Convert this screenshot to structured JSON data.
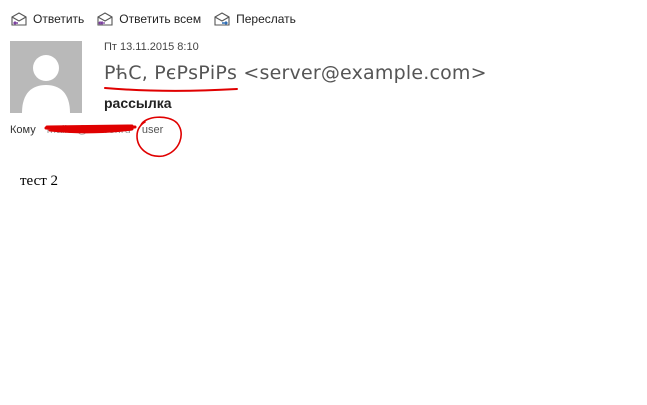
{
  "toolbar": {
    "reply_label": "Ответить",
    "reply_all_label": "Ответить всем",
    "forward_label": "Переслать"
  },
  "message": {
    "date": "Пт 13.11.2015 8:10",
    "sender_name": "РћС, РєРѕРіРѕ",
    "sender_email": "<server@example.com>",
    "subject": "рассылка",
    "to_label": "Кому",
    "to_redacted": "mailer@server.ru",
    "to_user": "user",
    "body_text": "тест 2"
  },
  "colors": {
    "annotation": "#e00000",
    "avatar_bg": "#b9b9b9",
    "icon_blue": "#2e6db4",
    "icon_purple": "#7a3e9d"
  }
}
